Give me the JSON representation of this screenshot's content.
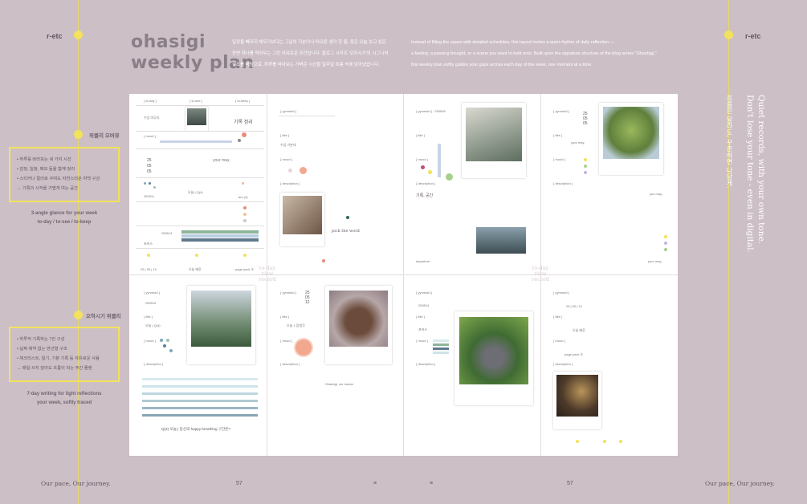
{
  "brand": {
    "left": "r-etc",
    "right": "r-etc"
  },
  "header": {
    "title_line1": "ohasigi",
    "title_line2": "weekly plan",
    "intro_ko": [
      "일정을 빼곡히 채우기보다는 그날의 기분이나 떠오른 생각 한 줄, 혹은 오늘 보고 싶은",
      "장면 하나를 적어두는 그런 여유로운 공간입니다. 블로그 시리즈 '오하시기'의 시그니처",
      "구조를 바탕으로, 하루를 바라보는 가벼운 시선을 일주일 흐름 속에 담아냈습니다."
    ],
    "intro_en": [
      "Instead of filling the space with detailed schedules, this layout invites a quiet rhythm of daily reflection —",
      "a feeling, a passing thought, or a scene you want to hold onto. Built upon the signature structure of the blog series \"Ohashigi,\"",
      "this weekly plan softly guides your gaze across each day of the week, one moment at a time."
    ]
  },
  "sections": {
    "overview_label": "위클리 오버뷰",
    "overview_items": [
      "• 하루를 바라보는 세 가지 시선",
      "• 감정, 일정, 메모 등을 함께 정리",
      "• 스티커나 컬러로 꾸며도 자연스러운 여백 구성",
      "→ 기록의 시작을 가볍게 여는 공간"
    ],
    "overview_caption_1": "3-angle glance for your week",
    "overview_caption_2": "to-day / to-see / to-keep",
    "weekly_label": "오하시기 위클리",
    "weekly_items": [
      "• 하루씩 기록하는 7칸 구성",
      "• 날짜 제약 없는 만년형 구조",
      "• 체크리스트, 일기, 기분 기록 등 자유로운 사용",
      "→ 매일 쓰지 않아도 흐름이 되는 주간 플랜"
    ],
    "weekly_caption_1": "7-day writing for light reflections",
    "weekly_caption_2": "your week, softly traced"
  },
  "vertical_text": {
    "korean": "흐름은 달라도, 꾸준하면 나답게.",
    "english_1": "Quiet records, with your own tone.",
    "english_2": "Don't lose your tone - even in digital."
  },
  "footer": {
    "left": "Our pace, Our journey.",
    "right": "Our pace, Our journey.",
    "marks": [
      "57",
      "≡",
      "≡",
      "57"
    ]
  },
  "sheet": {
    "col1": {
      "headers": [
        "{ to-day }",
        "{ to-see }",
        "{ to-keep }"
      ],
      "row1_left": "수업 마무리",
      "row1_right": "기록 정리",
      "mood_label": "{ mood }",
      "date_stack": [
        "25",
        "05",
        "05"
      ],
      "your_may": "your may.",
      "date_code": "250511",
      "today_q4": "오늘 | Q(4)",
      "am_label": "am (4)",
      "date_bar": "250514",
      "focus": "포커스",
      "footer_left": "25 | 05 | 19",
      "footer_mid": "오늘 배운",
      "footer_right": "page pack ①"
    },
    "col2": {
      "yymmdd": "{ yymmdd }",
      "title_label": "{ title }",
      "title_value": "수업 기본대",
      "mood_label": "{ mood }",
      "desc_label": "{ description }",
      "pick": "pick the word"
    },
    "col3": {
      "yymmdd": "{ yymmdd } : 250505",
      "title_label": "{ title }",
      "mood_label": "{ mood }",
      "desc_label": "{ description }",
      "desc_title": "기록, 공간",
      "bottom_label": "departure"
    },
    "col4": {
      "yymmdd": "{ yymmdd }",
      "date_stack": [
        "25",
        "05",
        "05"
      ],
      "title_label": "{ title }",
      "your_may": "your may.",
      "mood_label": "{ mood }",
      "desc_label": "{ description }",
      "you_may": "you may,",
      "your_may_bottom": "your may."
    },
    "watermark_1": [
      "to-day",
      "view",
      "record"
    ],
    "watermark_2": [
      "to-day",
      "view",
      "record"
    ],
    "bottom1": {
      "yymmdd": "{ yymmdd }",
      "date": "250515",
      "title_label": "{ title }",
      "title_value": "오늘 | Q(4)",
      "mood_label": "{ mood }",
      "desc_label": "{ description }",
      "caption": "Q(4) 오늘 | 당신의 happy breathing 구간은?"
    },
    "bottom2": {
      "yymmdd": "{ yymmdd }",
      "date_stack": [
        "25",
        "05",
        "12"
      ],
      "title_label": "{ title }",
      "title_value": "오늘 1 잡생각",
      "mood_label": "{ mood }",
      "desc_label": "{ description }",
      "english_note": "Ohashigi, our breeze"
    },
    "bottom3": {
      "yymmdd": "{ yymmdd }",
      "date": "250514",
      "title_label": "{ title }",
      "title_value": "포커스",
      "mood_label": "{ mood }",
      "desc_label": "{ description }"
    },
    "bottom4": {
      "yymmdd": "{ yymmdd }",
      "date": "25 | 05 | 19",
      "title_label": "{ title }",
      "title_value": "오늘 배운",
      "mood_label": "{ mood }",
      "mood_value": "page pack ①",
      "desc_label": "{ description }"
    }
  },
  "colors": {
    "background": "#cdbfc6",
    "accent_yellow": "#f2e25c",
    "sheet": "#ffffff"
  }
}
